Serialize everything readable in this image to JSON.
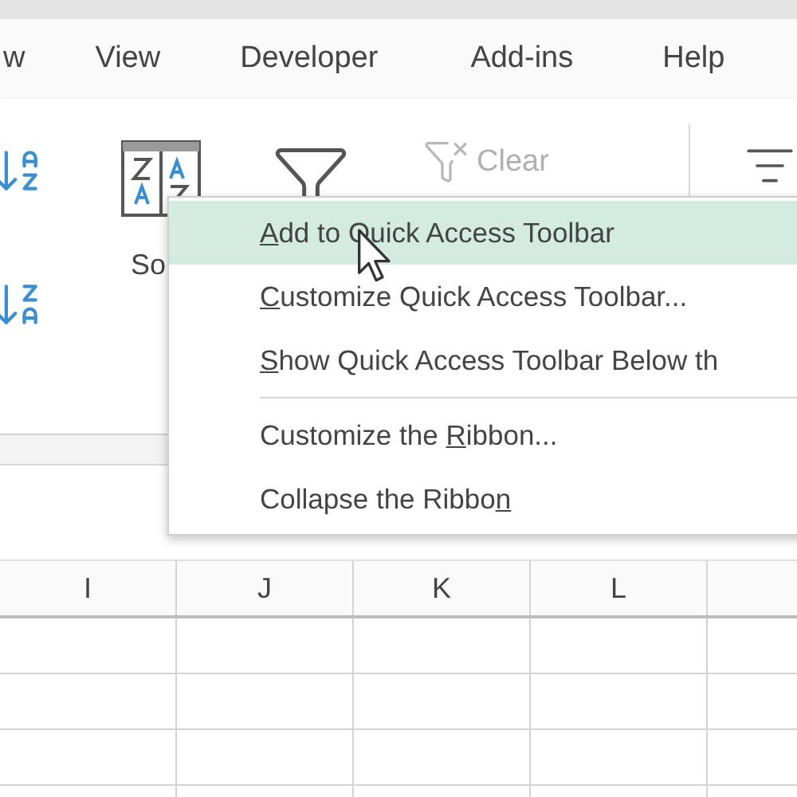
{
  "tabs": [
    {
      "label": "w",
      "selected": false
    },
    {
      "label": "View",
      "selected": false
    },
    {
      "label": "Developer",
      "selected": false
    },
    {
      "label": "Add-ins",
      "selected": false
    },
    {
      "label": "Help",
      "selected": false
    }
  ],
  "ribbon": {
    "sort_label": "So",
    "clear": {
      "label": "Clear",
      "disabled": true
    }
  },
  "context_menu": {
    "items": [
      {
        "kind": "item",
        "key": "A",
        "after": "dd to Quick Access Toolbar",
        "selected": true
      },
      {
        "kind": "item",
        "key": "C",
        "after": "ustomize Quick Access Toolbar...",
        "selected": false
      },
      {
        "kind": "item",
        "key": "S",
        "after": "how Quick Access Toolbar Below th",
        "selected": false
      },
      {
        "kind": "separator"
      },
      {
        "kind": "item",
        "before": "Customize the ",
        "key": "R",
        "after": "ibbon...",
        "selected": false
      },
      {
        "kind": "item",
        "before": "Collapse the Ribbo",
        "key": "n",
        "selected": false
      }
    ]
  },
  "sheet": {
    "columns": [
      "I",
      "J",
      "K",
      "L"
    ]
  }
}
